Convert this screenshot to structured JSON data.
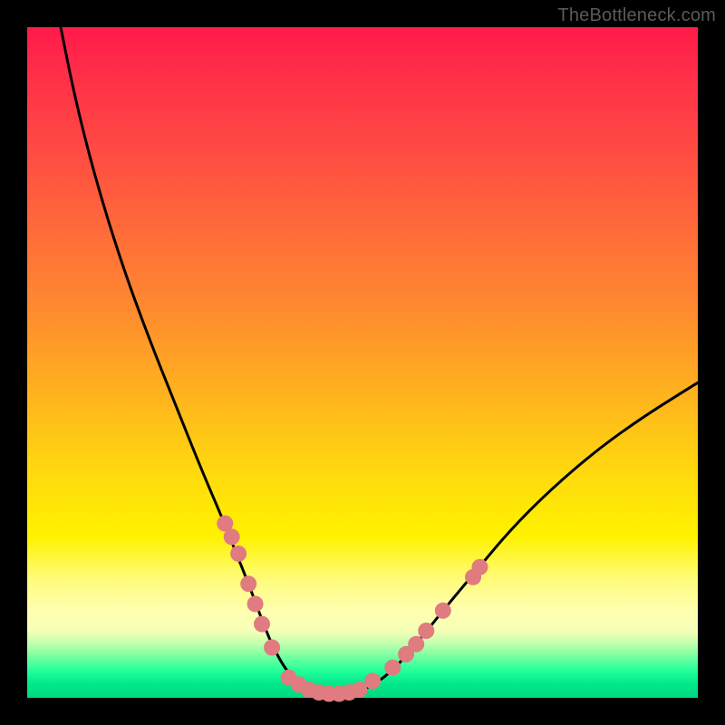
{
  "watermark": "TheBottleneck.com",
  "colors": {
    "frame_bg": "#000000",
    "gradient_top": "#ff1a4b",
    "gradient_mid": "#ffd80e",
    "gradient_bottom": "#00d97f",
    "curve": "#000000",
    "marker": "#e07b80"
  },
  "chart_data": {
    "type": "line",
    "title": "",
    "xlabel": "",
    "ylabel": "",
    "xlim": [
      0,
      100
    ],
    "ylim": [
      0,
      100
    ],
    "grid": false,
    "legend": false,
    "series": [
      {
        "name": "curve",
        "x": [
          5,
          7,
          10,
          14,
          18,
          22,
          26,
          29,
          31,
          33,
          34.5,
          36,
          38,
          40,
          42,
          44.5,
          47,
          50,
          54,
          58,
          62,
          67,
          72,
          78,
          85,
          92,
          100
        ],
        "y": [
          100,
          90,
          78,
          65,
          54,
          44,
          34,
          27,
          22,
          17,
          13,
          9,
          5,
          2.5,
          1,
          0.5,
          0.5,
          1,
          3.5,
          8,
          13,
          19,
          25,
          31,
          37,
          42,
          47
        ]
      }
    ],
    "markers": {
      "name": "dots",
      "points": [
        {
          "x": 29.5,
          "y": 26
        },
        {
          "x": 30.5,
          "y": 24
        },
        {
          "x": 31.5,
          "y": 21.5
        },
        {
          "x": 33.0,
          "y": 17
        },
        {
          "x": 34.0,
          "y": 14
        },
        {
          "x": 35.0,
          "y": 11
        },
        {
          "x": 36.5,
          "y": 7.5
        },
        {
          "x": 39.0,
          "y": 3
        },
        {
          "x": 40.5,
          "y": 2
        },
        {
          "x": 42.0,
          "y": 1.2
        },
        {
          "x": 43.5,
          "y": 0.8
        },
        {
          "x": 45.0,
          "y": 0.6
        },
        {
          "x": 46.5,
          "y": 0.6
        },
        {
          "x": 48.0,
          "y": 0.8
        },
        {
          "x": 49.5,
          "y": 1.2
        },
        {
          "x": 51.5,
          "y": 2.5
        },
        {
          "x": 54.5,
          "y": 4.5
        },
        {
          "x": 56.5,
          "y": 6.5
        },
        {
          "x": 58.0,
          "y": 8.0
        },
        {
          "x": 59.5,
          "y": 10.0
        },
        {
          "x": 62.0,
          "y": 13.0
        },
        {
          "x": 66.5,
          "y": 18.0
        },
        {
          "x": 67.5,
          "y": 19.5
        }
      ]
    }
  }
}
